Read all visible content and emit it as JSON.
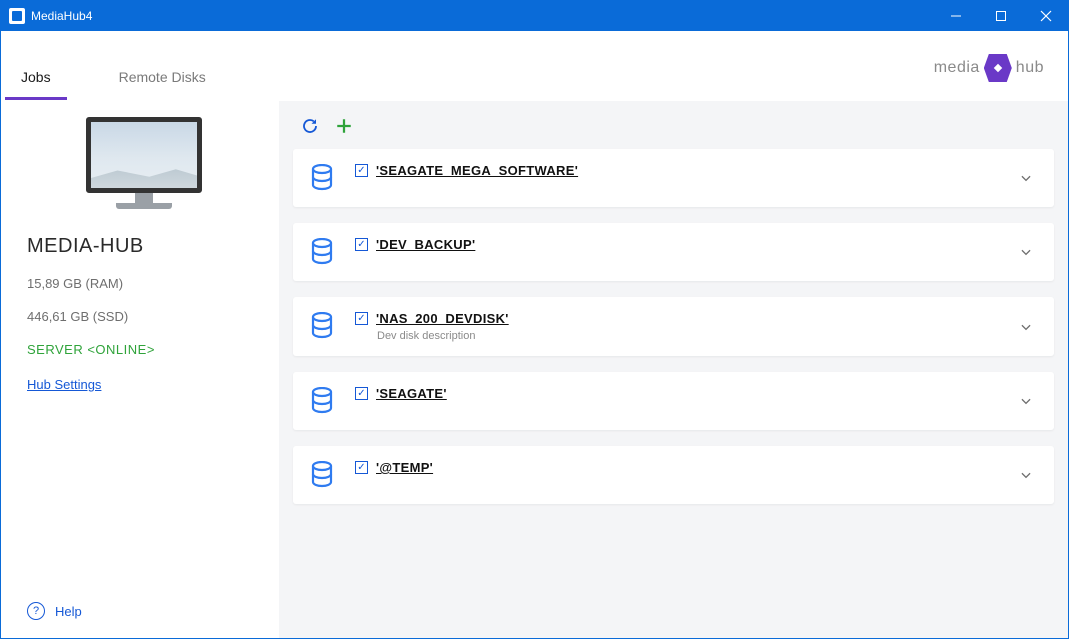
{
  "window": {
    "title": "MediaHub4"
  },
  "tabs": {
    "jobs": "Jobs",
    "remote": "Remote Disks",
    "activeIndex": 0
  },
  "brand": {
    "text_left": "media",
    "text_right": "hub"
  },
  "sidebar": {
    "host": "MEDIA-HUB",
    "ram": "15,89 GB (RAM)",
    "ssd": "446,61 GB (SSD)",
    "status": "SERVER <ONLINE>",
    "settings": "Hub Settings",
    "help": "Help"
  },
  "disks": [
    {
      "name": "'SEAGATE_MEGA_SOFTWARE'",
      "checked": true,
      "desc": ""
    },
    {
      "name": "'DEV_BACKUP'",
      "checked": true,
      "desc": ""
    },
    {
      "name": "'NAS_200_DEVDISK'",
      "checked": true,
      "desc": "Dev disk description"
    },
    {
      "name": "'SEAGATE'",
      "checked": true,
      "desc": ""
    },
    {
      "name": "'@TEMP'",
      "checked": true,
      "desc": ""
    }
  ]
}
